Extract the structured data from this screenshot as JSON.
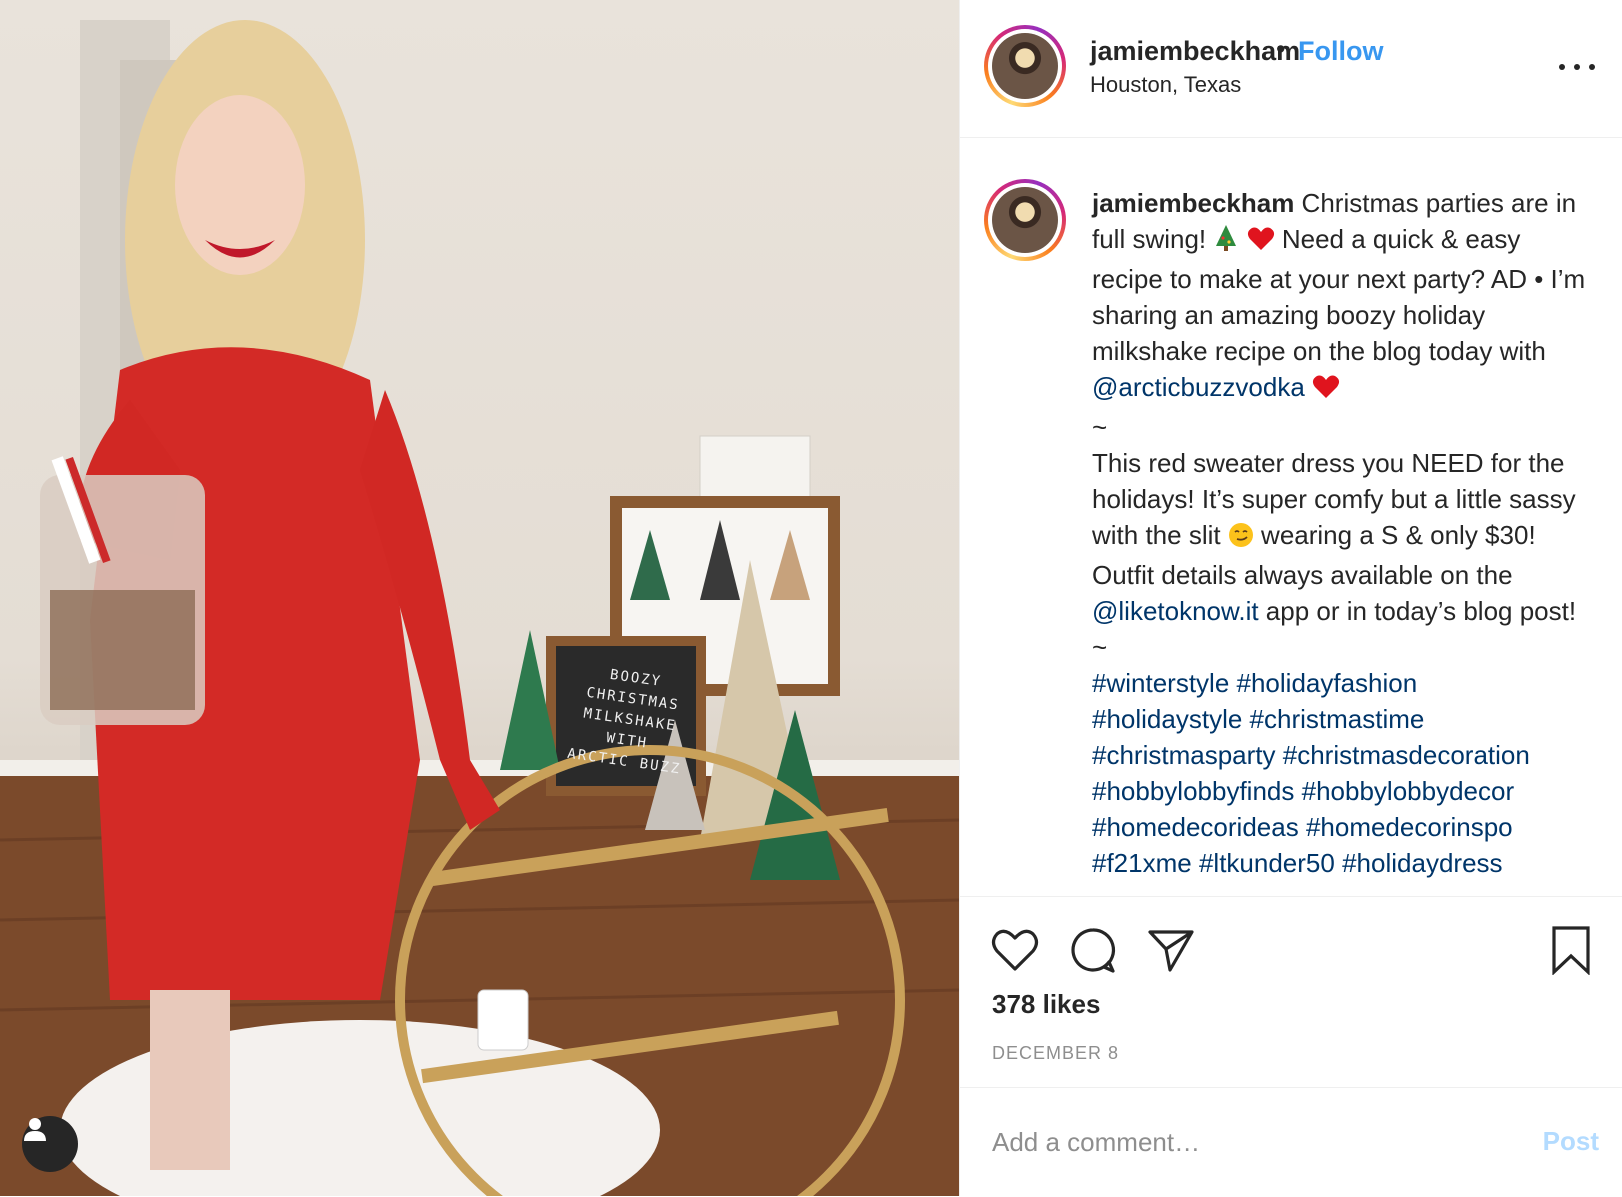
{
  "post": {
    "username": "jamiembeckham",
    "separator": "•",
    "follow_label": "Follow",
    "location": "Houston, Texas",
    "caption": {
      "username": "jamiembeckham",
      "p1": " Christmas parties are in full swing! ",
      "p2": "  Need a quick & easy recipe to make at your next party? AD • I’m sharing an amazing boozy holiday milkshake recipe on the blog today with ",
      "mention1": "@arcticbuzzvodka",
      "tilde1": "~",
      "p3": "This red sweater dress you NEED for the holidays! It’s super comfy but a little sassy with the slit ",
      "p4": "  wearing a S & only $30! Outfit details always available on the ",
      "mention2": "@liketoknow.it",
      "p5": " app or in today’s blog post!",
      "tilde2": "~",
      "hashtags": [
        "#winterstyle",
        "#holidayfashion",
        "#holidaystyle",
        "#christmastime",
        "#christmasparty",
        "#christmasdecoration",
        "#hobbylobbyfinds",
        "#hobbylobbydecor",
        "#homedecorideas",
        "#homedecorinspo",
        "#f21xme",
        "#ltkunder50",
        "#holidaydress"
      ]
    },
    "likes": "378 likes",
    "date": "DECEMBER 8",
    "comment_placeholder": "Add a comment…",
    "post_label": "Post",
    "photo_sign": [
      "BOOZY",
      "CHRISTMAS",
      "MILKSHAKE",
      "WITH",
      "ARCTIC BUZZ"
    ]
  },
  "icons": {
    "more": "more-options-icon",
    "like": "heart-icon",
    "comment": "comment-icon",
    "share": "send-icon",
    "save": "bookmark-icon",
    "tag": "user-tag-icon"
  },
  "colors": {
    "link": "#003569",
    "follow": "#3897f0",
    "post_disabled": "#b3dbff",
    "muted": "#8e8e8e"
  }
}
